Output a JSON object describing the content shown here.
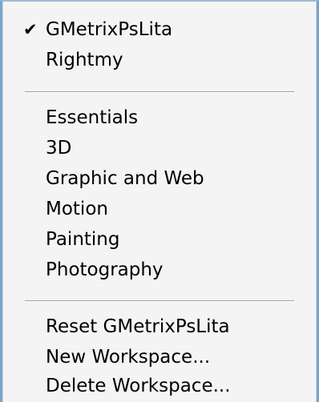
{
  "menu": {
    "checked_icon": "checkmark-icon",
    "sections": [
      {
        "items": [
          {
            "label": "GMetrixPsLita",
            "checked": true
          },
          {
            "label": "Rightmy",
            "checked": false
          }
        ]
      },
      {
        "items": [
          {
            "label": "Essentials"
          },
          {
            "label": "3D"
          },
          {
            "label": "Graphic and Web"
          },
          {
            "label": "Motion"
          },
          {
            "label": "Painting"
          },
          {
            "label": "Photography"
          }
        ]
      },
      {
        "items": [
          {
            "label": "Reset GMetrixPsLita"
          },
          {
            "label": "New Workspace..."
          },
          {
            "label": "Delete Workspace..."
          }
        ]
      }
    ],
    "check_glyph": "✔"
  }
}
